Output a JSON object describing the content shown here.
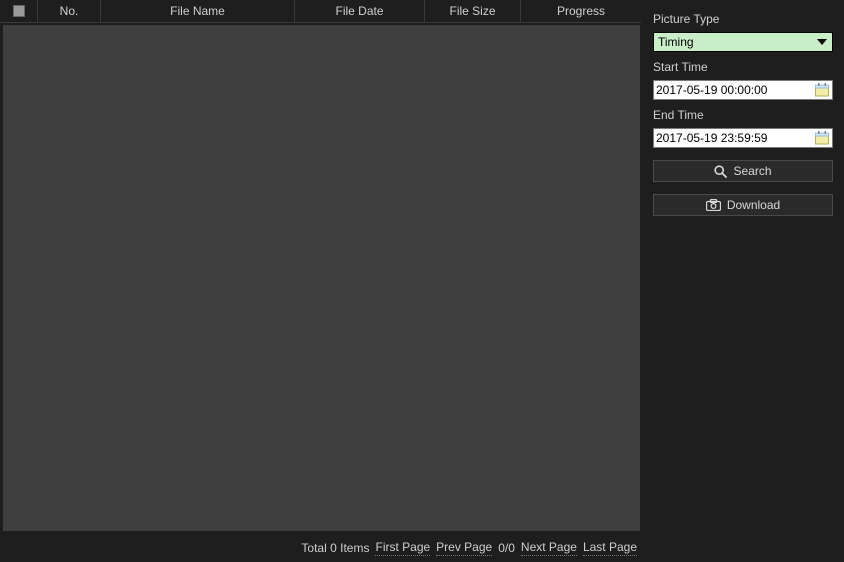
{
  "table": {
    "columns": {
      "no": "No.",
      "file_name": "File Name",
      "file_date": "File Date",
      "file_size": "File Size",
      "progress": "Progress"
    }
  },
  "footer": {
    "total_prefix": "Total",
    "total_count": "0",
    "total_suffix": "Items",
    "first_page": "First Page",
    "prev_page": "Prev Page",
    "page_indicator": "0/0",
    "next_page": "Next Page",
    "last_page": "Last Page"
  },
  "sidebar": {
    "picture_type_label": "Picture Type",
    "picture_type_value": "Timing",
    "start_time_label": "Start Time",
    "start_time_value": "2017-05-19 00:00:00",
    "end_time_label": "End Time",
    "end_time_value": "2017-05-19 23:59:59",
    "search_label": "Search",
    "download_label": "Download"
  }
}
